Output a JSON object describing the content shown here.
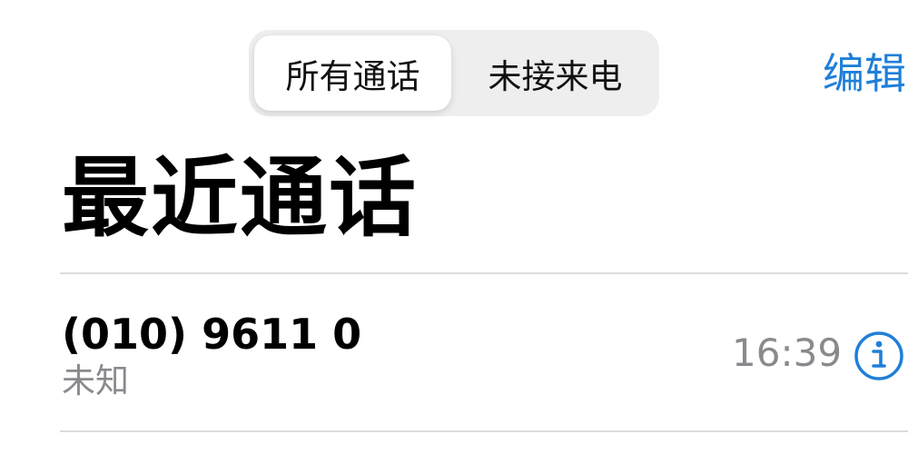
{
  "segmented_control": {
    "all_calls_label": "所有通话",
    "missed_label": "未接来电",
    "selected": "所有通话"
  },
  "header": {
    "edit_label": "编辑",
    "title": "最近通话"
  },
  "calls": [
    {
      "number": "(010) 9611 0",
      "label": "未知",
      "time": "16:39",
      "info_icon": "info-circle-icon"
    }
  ],
  "colors": {
    "accent": "#1f7fd8",
    "secondary_text": "#8a8a8e",
    "segment_background": "#eeeeef",
    "divider": "#dcdcde"
  }
}
